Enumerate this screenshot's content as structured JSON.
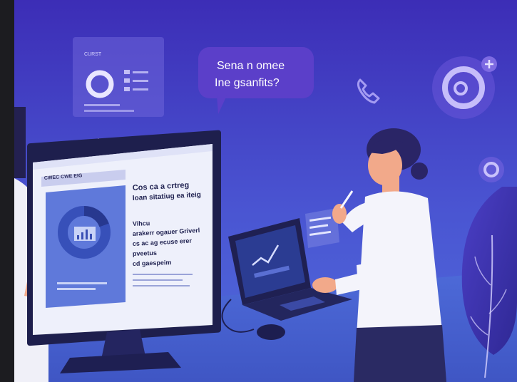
{
  "speech_bubble": {
    "line1": "Sena n omee",
    "line2": "Ine gsanfits?"
  },
  "floating_card": {
    "label": "CURST"
  },
  "monitor": {
    "header": "CWEC CWE EIG",
    "heading_line1": "Cos ca a crtreg",
    "heading_line2": "Ioan sitatiug ea iteig",
    "body_lines": [
      "Vihcu",
      "arakerr ogauer Griverl",
      "cs ac ag ecuse erer",
      "pveetus",
      "cd gaespeim"
    ]
  },
  "colors": {
    "background_top": "#3a2fb8",
    "background_bottom": "#4c64d6",
    "accent_purple": "#7a55e0",
    "monitor_frame": "#1e1f4d",
    "shirt": "#f4f4fb",
    "pants": "#2a2a63",
    "skin": "#f2a98a",
    "hair": "#2a2566"
  }
}
